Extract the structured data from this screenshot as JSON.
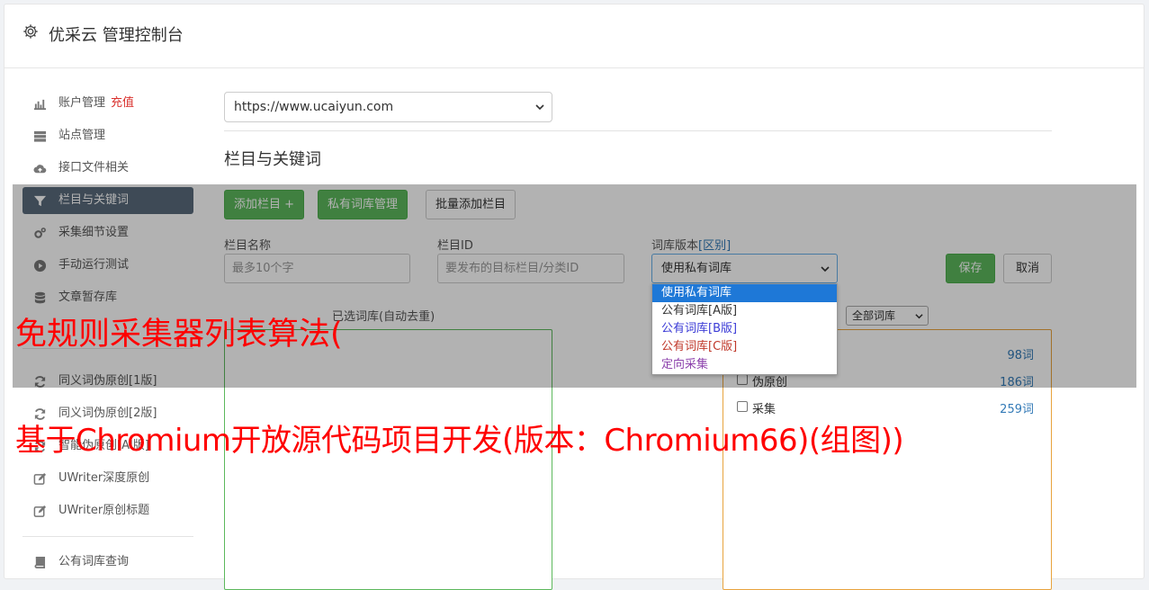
{
  "header": {
    "title": "优采云 管理控制台"
  },
  "sidebar": {
    "items": [
      {
        "label": "账户管理",
        "badge": "充值",
        "icon": "bar-chart-icon"
      },
      {
        "label": "站点管理",
        "icon": "server-icon"
      },
      {
        "label": "接口文件相关",
        "icon": "cloud-upload-icon"
      },
      {
        "label": "栏目与关键词",
        "icon": "filter-icon",
        "active": true
      },
      {
        "label": "采集细节设置",
        "icon": "cogs-icon"
      },
      {
        "label": "手动运行测试",
        "icon": "play-circle-icon"
      },
      {
        "label": "文章暂存库",
        "icon": "database-icon"
      },
      {
        "label": "同义词伪原创[1版]",
        "icon": "refresh-icon"
      },
      {
        "label": "同义词伪原创[2版]",
        "icon": "refresh-icon"
      },
      {
        "label": "智能伪原创[AI版]",
        "icon": "refresh-icon"
      },
      {
        "label": "UWriter深度原创",
        "icon": "edit-icon"
      },
      {
        "label": "UWriter原创标题",
        "icon": "edit-icon"
      },
      {
        "label": "公有词库查询",
        "icon": "book-icon"
      }
    ]
  },
  "main": {
    "site_select": "https://www.ucaiyun.com",
    "section_title": "栏目与关键词",
    "buttons": {
      "add_column": "添加栏目 +",
      "private_lib": "私有词库管理",
      "batch_add": "批量添加栏目",
      "save": "保存",
      "cancel": "取消"
    },
    "form": {
      "column_name_label": "栏目名称",
      "column_name_placeholder": "最多10个字",
      "column_id_label": "栏目ID",
      "column_id_placeholder": "要发布的目标栏目/分类ID",
      "lib_version_label": "词库版本",
      "lib_version_link": "[区别]",
      "lib_version_value": "使用私有词库"
    },
    "dropdown_options": [
      {
        "label": "使用私有词库",
        "color": "#ffffff",
        "selected": true
      },
      {
        "label": "公有词库[A版]",
        "color": "#333333"
      },
      {
        "label": "公有词库[B版]",
        "color": "#3b3bd6"
      },
      {
        "label": "公有词库[C版]",
        "color": "#c0392b"
      },
      {
        "label": "定向采集",
        "color": "#8e44ad"
      }
    ],
    "selected_keywords_title": "已选词库(自动去重)",
    "lib_filter": "全部词库",
    "libs": [
      {
        "name": "",
        "count": "98词"
      },
      {
        "name": "伪原创",
        "count": "186词"
      },
      {
        "name": "采集",
        "count": "259词"
      }
    ]
  },
  "watermarks": {
    "line1": "免规则采集器列表算法(",
    "line2": "基于Chromium开放源代码项目开发(版本：Chromium66)(组图))"
  },
  "colors": {
    "accent_green": "#5cb85c",
    "active_nav": "#5a6b7b",
    "watermark": "#ff0000",
    "link": "#337ab7"
  }
}
